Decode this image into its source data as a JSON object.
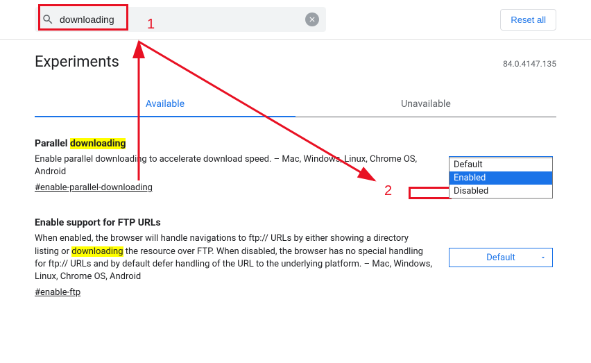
{
  "search": {
    "value": "downloading"
  },
  "reset_label": "Reset all",
  "page_title": "Experiments",
  "version": "84.0.4147.135",
  "tabs": {
    "available": "Available",
    "unavailable": "Unavailable"
  },
  "flags": [
    {
      "title_pre": "Parallel ",
      "title_hl": "downloading",
      "desc": "Enable parallel downloading to accelerate download speed. – Mac, Windows, Linux, Chrome OS, Android",
      "anchor": "#enable-parallel-downloading",
      "select_value": "Default",
      "dropdown": [
        "Default",
        "Enabled",
        "Disabled"
      ]
    },
    {
      "title": "Enable support for FTP URLs",
      "desc_pre": "When enabled, the browser will handle navigations to ftp:// URLs by either showing a directory listing or ",
      "desc_hl": "downloading",
      "desc_post": " the resource over FTP. When disabled, the browser has no special handling for ftp:// URLs and by default defer handling of the URL to the underlying platform. – Mac, Windows, Linux, Chrome OS, Android",
      "anchor": "#enable-ftp",
      "select_value": "Default"
    }
  ],
  "annotations": {
    "label1": "1",
    "label2": "2"
  }
}
